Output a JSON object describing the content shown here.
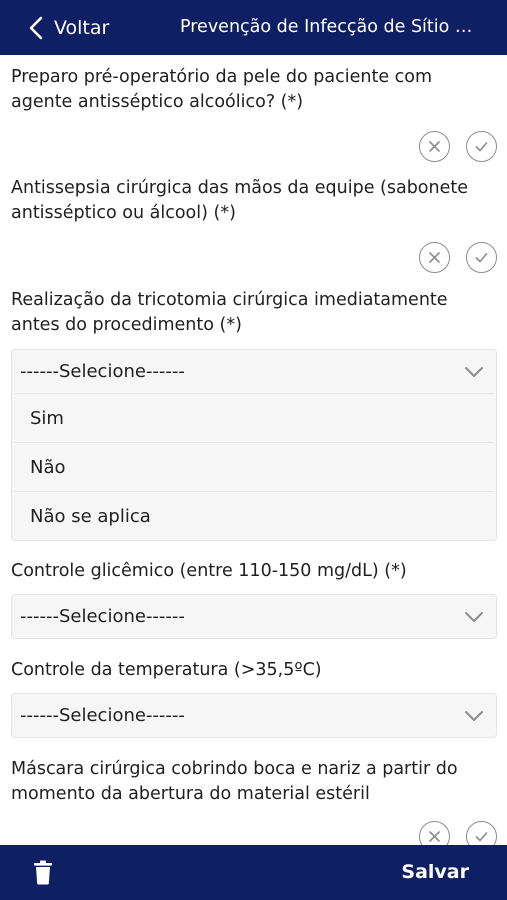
{
  "header": {
    "back_label": "Voltar",
    "title": "Prevenção de Infecção de Sítio C..."
  },
  "questions": {
    "q1": "Preparo pré-operatório da pele do paciente com agente antisséptico alcoólico? (*)",
    "q2": "Antissepsia cirúrgica das mãos da equipe (sabonete antisséptico ou álcool) (*)",
    "q3": "Realização da tricotomia cirúrgica imediatamente antes do procedimento (*)",
    "q4": "Controle glicêmico (entre 110-150 mg/dL) (*)",
    "q5": "Controle da temperatura (>35,5ºC)",
    "q6": "Máscara cirúrgica cobrindo boca e nariz a partir do momento da abertura do material estéril"
  },
  "select": {
    "placeholder": "------Selecione------",
    "options": [
      "Sim",
      "Não",
      "Não se aplica"
    ]
  },
  "footer": {
    "save_label": "Salvar"
  },
  "colors": {
    "bar": "#0f1f63",
    "select_bg": "#f6f6f6",
    "icon_gray": "#8c8c8c"
  }
}
